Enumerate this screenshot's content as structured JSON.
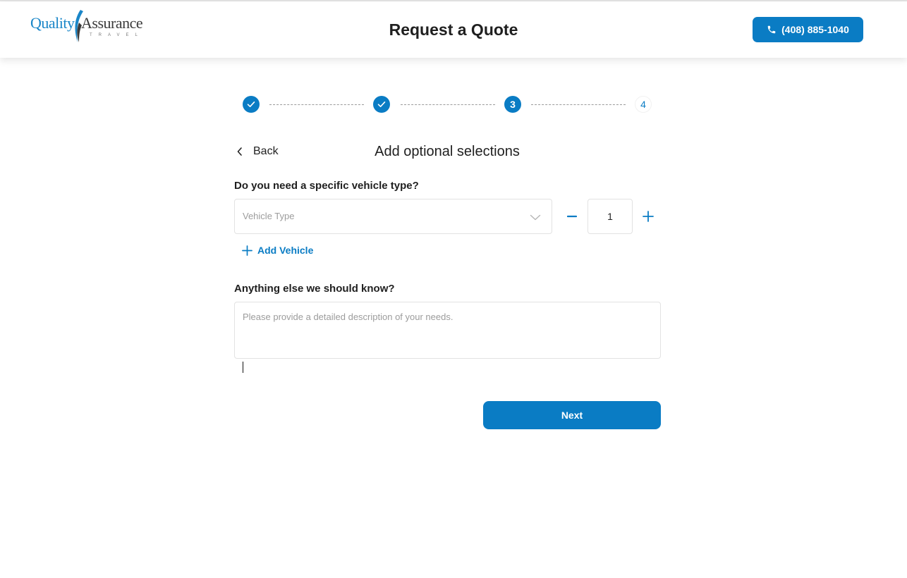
{
  "header": {
    "logo": {
      "word1": "Quality",
      "word2": "Assurance",
      "tagline": "TRAVEL"
    },
    "title": "Request a Quote",
    "phone_label": "(408) 885-1040"
  },
  "stepper": {
    "steps": [
      {
        "state": "done",
        "label": ""
      },
      {
        "state": "done",
        "label": ""
      },
      {
        "state": "active",
        "label": "3"
      },
      {
        "state": "pending",
        "label": "4"
      }
    ]
  },
  "nav": {
    "back_label": "Back"
  },
  "section": {
    "title": "Add optional selections"
  },
  "vehicle": {
    "question": "Do you need a specific vehicle type?",
    "select_placeholder": "Vehicle Type",
    "quantity": "1",
    "add_label": "Add Vehicle"
  },
  "notes": {
    "question": "Anything else we should know?",
    "placeholder": "Please provide a detailed description of your needs."
  },
  "actions": {
    "next_label": "Next"
  },
  "colors": {
    "accent": "#0a7cc4",
    "border": "#e2e2e2",
    "placeholder": "#9c9c9c"
  }
}
